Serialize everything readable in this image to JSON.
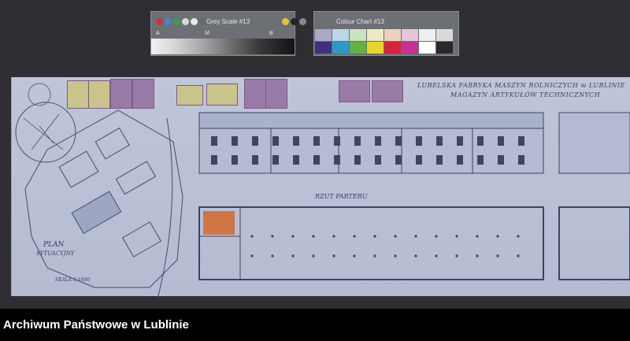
{
  "grey_card": {
    "title": "Grey Scale #13",
    "top_letters": [
      "A",
      "M",
      "B"
    ],
    "bottom_letters": [
      "A",
      "M",
      "B"
    ],
    "swatch_colors": [
      "#c8343e",
      "#3e8bc8",
      "#3c9a53",
      "#d7d7d7",
      "#e8e8e8",
      "#6a6a6a",
      "#d0d0d0",
      "#3aa5c8",
      "#c03a8e",
      "#e2c62e",
      "#222222",
      "#8a8a8a"
    ]
  },
  "colour_card": {
    "title": "Colour Chart #13",
    "swatch_rows": [
      [
        "#ada6c9",
        "#b9d7e6",
        "#c9e3c0",
        "#efe9c1",
        "#ead2be",
        "#e5c6d8",
        "#efefef",
        "#d9d9d9"
      ],
      [
        "#3e2f7f",
        "#2b9ac9",
        "#64b148",
        "#e6d82a",
        "#d7233a",
        "#c63192",
        "#ffffff",
        "#2a2a2a"
      ]
    ]
  },
  "drawing": {
    "title_line1": "LUBELSKA FABRYKA MASZYN ROLNICZYCH w LUBLINIE",
    "title_line2": "MAGAZYN ARTYKUŁÓW TECHNICZNYCH",
    "floor_plan_label": "RZUT PARTERU",
    "site_plan_title": "PLAN",
    "site_plan_subtitle": "SYTUACYJNY",
    "scale_note": "SKALA 1:1000"
  },
  "caption": {
    "text": "Archiwum Państwowe w Lublinie"
  }
}
